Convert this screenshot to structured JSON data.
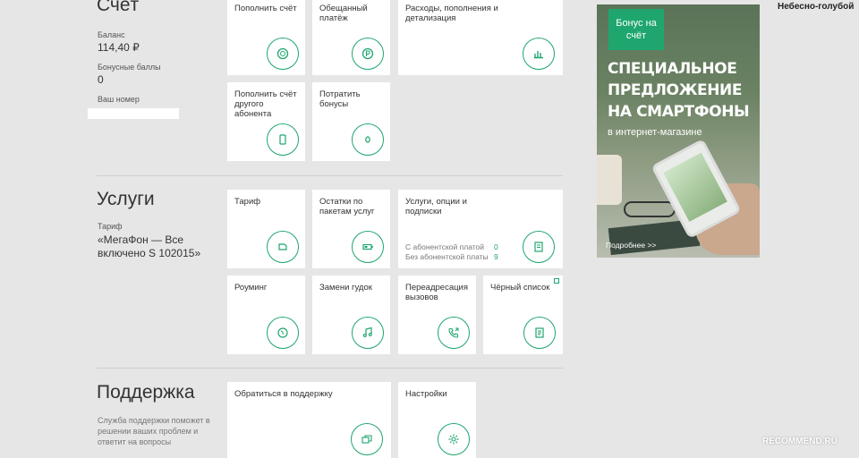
{
  "account": {
    "title": "Счёт",
    "balance_label": "Баланс",
    "balance_value": "114,40 ₽",
    "bonus_label": "Бонусные баллы",
    "bonus_value": "0",
    "number_label": "Ваш номер"
  },
  "account_tiles": {
    "topup": "Пополнить счёт",
    "promised": "Обещанный платёж",
    "expenses": "Расходы, пополнения и детализация",
    "topup_other": "Пополнить счёт другого абонента",
    "spend_bonus": "Потратить бонусы"
  },
  "services": {
    "title": "Услуги",
    "tariff_label": "Тариф",
    "tariff_value": "«МегаФон — Все включено S 102015»"
  },
  "service_tiles": {
    "tariff": "Тариф",
    "remains": "Остатки по пакетам услуг",
    "options": "Услуги, опции и подписки",
    "paid_label": "С абонентской платой",
    "paid_count": "0",
    "free_label": "Без абонентской платы",
    "free_count": "9",
    "roaming": "Роуминг",
    "ringtone": "Замени гудок",
    "forwarding": "Переадресация вызовов",
    "blacklist": "Чёрный список"
  },
  "support": {
    "title": "Поддержка",
    "description": "Служба поддержки поможет в решении ваших проблем и ответит на вопросы"
  },
  "support_tiles": {
    "contact": "Обратиться в поддержку",
    "settings": "Настройки"
  },
  "ad": {
    "badge": "Бонус на счёт",
    "headline_line1": "СПЕЦИАЛЬНОЕ",
    "headline_line2": "ПРЕДЛОЖЕНИЕ",
    "headline_line3": "НА СМАРТФОНЫ",
    "subline": "в интернет-магазине",
    "more_link": "Подробнее >>"
  },
  "theme_name": "Небесно-голубой",
  "watermark": "RECOMMEND.RU",
  "colors": {
    "accent": "#1fa66e",
    "background": "#e6e6e6",
    "tile": "#ffffff"
  }
}
